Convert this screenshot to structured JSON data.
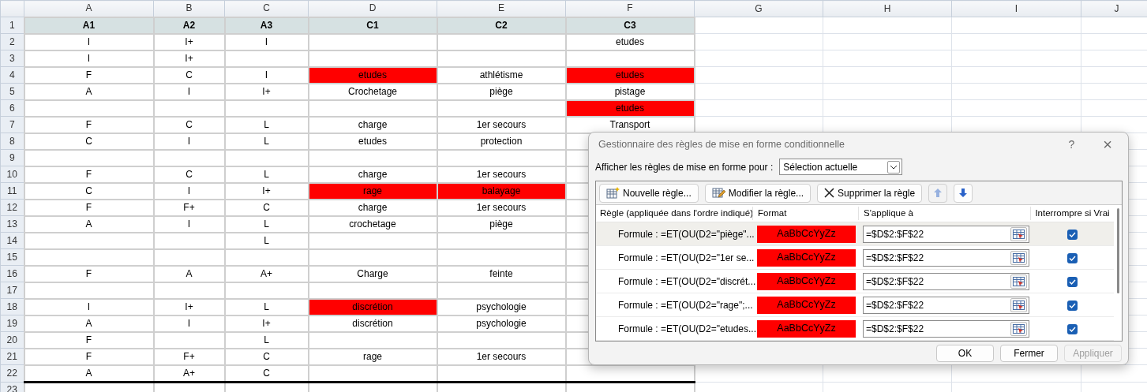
{
  "sheet": {
    "columns": [
      "A",
      "B",
      "C",
      "D",
      "E",
      "F",
      "G",
      "H",
      "I",
      "J"
    ],
    "rows": [
      {
        "number": "1",
        "header": true,
        "cells": [
          {
            "text": "A1",
            "highlighted": false
          },
          {
            "text": "A2",
            "highlighted": false
          },
          {
            "text": "A3",
            "highlighted": false
          },
          {
            "text": "C1",
            "highlighted": false
          },
          {
            "text": "C2",
            "highlighted": false
          },
          {
            "text": "C3",
            "highlighted": false
          }
        ]
      },
      {
        "number": "2",
        "header": false,
        "cells": [
          {
            "text": "I",
            "highlighted": false
          },
          {
            "text": "I+",
            "highlighted": false
          },
          {
            "text": "I",
            "highlighted": false
          },
          {
            "highlighted": false
          },
          {
            "highlighted": false
          },
          {
            "text": "etudes",
            "highlighted": false
          }
        ]
      },
      {
        "number": "3",
        "header": false,
        "cells": [
          {
            "text": "I",
            "highlighted": false
          },
          {
            "text": "I+",
            "highlighted": false
          },
          {
            "highlighted": false
          },
          {
            "highlighted": false
          },
          {
            "highlighted": false
          },
          {
            "highlighted": false
          }
        ]
      },
      {
        "number": "4",
        "header": false,
        "cells": [
          {
            "text": "F",
            "highlighted": false
          },
          {
            "text": "C",
            "highlighted": false
          },
          {
            "text": "I",
            "highlighted": false
          },
          {
            "text": "etudes",
            "highlighted": true
          },
          {
            "text": "athlétisme",
            "highlighted": false
          },
          {
            "text": "etudes",
            "highlighted": true
          }
        ]
      },
      {
        "number": "5",
        "header": false,
        "cells": [
          {
            "text": "A",
            "highlighted": false
          },
          {
            "text": "I",
            "highlighted": false
          },
          {
            "text": "I+",
            "highlighted": false
          },
          {
            "text": "Crochetage",
            "highlighted": false
          },
          {
            "text": "piège",
            "highlighted": false
          },
          {
            "text": "pistage",
            "highlighted": false
          }
        ]
      },
      {
        "number": "6",
        "header": false,
        "cells": [
          {
            "highlighted": false
          },
          {
            "highlighted": false
          },
          {
            "highlighted": false
          },
          {
            "highlighted": false
          },
          {
            "highlighted": false
          },
          {
            "text": "etudes",
            "highlighted": true
          }
        ]
      },
      {
        "number": "7",
        "header": false,
        "cells": [
          {
            "text": "F",
            "highlighted": false
          },
          {
            "text": "C",
            "highlighted": false
          },
          {
            "text": "L",
            "highlighted": false
          },
          {
            "text": "charge",
            "highlighted": false
          },
          {
            "text": "1er secours",
            "highlighted": false
          },
          {
            "text": "Transport",
            "highlighted": false
          }
        ]
      },
      {
        "number": "8",
        "header": false,
        "cells": [
          {
            "text": "C",
            "highlighted": false
          },
          {
            "text": "I",
            "highlighted": false
          },
          {
            "text": "L",
            "highlighted": false
          },
          {
            "text": "etudes",
            "highlighted": false
          },
          {
            "text": "protection",
            "highlighted": false
          },
          {
            "highlighted": false
          }
        ]
      },
      {
        "number": "9",
        "header": false,
        "cells": [
          {
            "highlighted": false
          },
          {
            "highlighted": false
          },
          {
            "highlighted": false
          },
          {
            "highlighted": false
          },
          {
            "highlighted": false
          },
          {
            "highlighted": false
          }
        ]
      },
      {
        "number": "10",
        "header": false,
        "cells": [
          {
            "text": "F",
            "highlighted": false
          },
          {
            "text": "C",
            "highlighted": false
          },
          {
            "text": "L",
            "highlighted": false
          },
          {
            "text": "charge",
            "highlighted": false
          },
          {
            "text": "1er secours",
            "highlighted": false
          },
          {
            "highlighted": false
          }
        ]
      },
      {
        "number": "11",
        "header": false,
        "cells": [
          {
            "text": "C",
            "highlighted": false
          },
          {
            "text": "I",
            "highlighted": false
          },
          {
            "text": "I+",
            "highlighted": false
          },
          {
            "text": "rage",
            "highlighted": true
          },
          {
            "text": "balayage",
            "highlighted": true
          },
          {
            "highlighted": false
          }
        ]
      },
      {
        "number": "12",
        "header": false,
        "cells": [
          {
            "text": "F",
            "highlighted": false
          },
          {
            "text": "F+",
            "highlighted": false
          },
          {
            "text": "C",
            "highlighted": false
          },
          {
            "text": "charge",
            "highlighted": false
          },
          {
            "text": "1er secours",
            "highlighted": false
          },
          {
            "highlighted": false
          }
        ]
      },
      {
        "number": "13",
        "header": false,
        "cells": [
          {
            "text": "A",
            "highlighted": false
          },
          {
            "text": "I",
            "highlighted": false
          },
          {
            "text": "L",
            "highlighted": false
          },
          {
            "text": "crochetage",
            "highlighted": false
          },
          {
            "text": "piège",
            "highlighted": false
          },
          {
            "highlighted": false
          }
        ]
      },
      {
        "number": "14",
        "header": false,
        "cells": [
          {
            "highlighted": false
          },
          {
            "highlighted": false
          },
          {
            "text": "L",
            "highlighted": false
          },
          {
            "highlighted": false
          },
          {
            "highlighted": false
          },
          {
            "highlighted": false
          }
        ]
      },
      {
        "number": "15",
        "header": false,
        "cells": [
          {
            "highlighted": false
          },
          {
            "highlighted": false
          },
          {
            "highlighted": false
          },
          {
            "highlighted": false
          },
          {
            "highlighted": false
          },
          {
            "highlighted": false
          }
        ]
      },
      {
        "number": "16",
        "header": false,
        "cells": [
          {
            "text": "F",
            "highlighted": false
          },
          {
            "text": "A",
            "highlighted": false
          },
          {
            "text": "A+",
            "highlighted": false
          },
          {
            "text": "Charge",
            "highlighted": false
          },
          {
            "text": "feinte",
            "highlighted": false
          },
          {
            "highlighted": false
          }
        ]
      },
      {
        "number": "17",
        "header": false,
        "cells": [
          {
            "highlighted": false
          },
          {
            "highlighted": false
          },
          {
            "highlighted": false
          },
          {
            "highlighted": false
          },
          {
            "highlighted": false
          },
          {
            "highlighted": false
          }
        ]
      },
      {
        "number": "18",
        "header": false,
        "cells": [
          {
            "text": "I",
            "highlighted": false
          },
          {
            "text": "I+",
            "highlighted": false
          },
          {
            "text": "L",
            "highlighted": false
          },
          {
            "text": "discrétion",
            "highlighted": true
          },
          {
            "text": "psychologie",
            "highlighted": false
          },
          {
            "highlighted": false
          }
        ]
      },
      {
        "number": "19",
        "header": false,
        "cells": [
          {
            "text": "A",
            "highlighted": false
          },
          {
            "text": "I",
            "highlighted": false
          },
          {
            "text": "I+",
            "highlighted": false
          },
          {
            "text": "discrétion",
            "highlighted": false
          },
          {
            "text": "psychologie",
            "highlighted": false
          },
          {
            "highlighted": false
          }
        ]
      },
      {
        "number": "20",
        "header": false,
        "cells": [
          {
            "text": "F",
            "highlighted": false
          },
          {
            "highlighted": false
          },
          {
            "text": "L",
            "highlighted": false
          },
          {
            "highlighted": false
          },
          {
            "highlighted": false
          },
          {
            "highlighted": false
          }
        ]
      },
      {
        "number": "21",
        "header": false,
        "cells": [
          {
            "text": "F",
            "highlighted": false
          },
          {
            "text": "F+",
            "highlighted": false
          },
          {
            "text": "C",
            "highlighted": false
          },
          {
            "text": "rage",
            "highlighted": false
          },
          {
            "text": "1er secours",
            "highlighted": false
          },
          {
            "highlighted": false
          }
        ]
      },
      {
        "number": "22",
        "header": false,
        "cells": [
          {
            "text": "A",
            "highlighted": false
          },
          {
            "text": "A+",
            "highlighted": false
          },
          {
            "text": "C",
            "highlighted": false
          },
          {
            "highlighted": false
          },
          {
            "highlighted": false
          },
          {
            "highlighted": false
          }
        ]
      },
      {
        "number": "23",
        "header": false,
        "cells": [
          {
            "highlighted": false
          },
          {
            "highlighted": false
          },
          {
            "highlighted": false
          },
          {
            "highlighted": false
          },
          {
            "highlighted": false
          },
          {
            "highlighted": false
          }
        ]
      }
    ]
  },
  "dialog": {
    "title": "Gestionnaire des règles de mise en forme conditionnelle",
    "help": "?",
    "close": "×",
    "scope_label": "Afficher les règles de mise en forme pour :",
    "scope_value": "Sélection actuelle",
    "toolbar": [
      {
        "kind": "new",
        "label": "Nouvelle règle...",
        "disabled": false
      },
      {
        "kind": "edit",
        "label": "Modifier la règle...",
        "disabled": false
      },
      {
        "kind": "delete",
        "label": "Supprimer la règle",
        "disabled": false
      },
      {
        "kind": "up",
        "disabled": true
      },
      {
        "kind": "down",
        "disabled": false
      }
    ],
    "columns": [
      "Règle (appliquée dans l'ordre indiqué)",
      "Format",
      "S'applique à",
      "Interrompre si Vrai"
    ],
    "rules": [
      {
        "rule": "Formule : =ET(OU(D2=\"piège\"...",
        "format": "AaBbCcYyZz",
        "color": "#ff0000",
        "applies_to": "=$D$2:$F$22",
        "checked": true,
        "selected": true
      },
      {
        "rule": "Formule : =ET(OU(D2=\"1er se...",
        "format": "AaBbCcYyZz",
        "color": "#ff0000",
        "applies_to": "=$D$2:$F$22",
        "checked": true,
        "selected": false
      },
      {
        "rule": "Formule : =ET(OU(D2=\"discrét...",
        "format": "AaBbCcYyZz",
        "color": "#ff0000",
        "applies_to": "=$D$2:$F$22",
        "checked": true,
        "selected": false
      },
      {
        "rule": "Formule : =ET(OU(D2=\"rage\";...",
        "format": "AaBbCcYyZz",
        "color": "#ff0000",
        "applies_to": "=$D$2:$F$22",
        "checked": true,
        "selected": false
      },
      {
        "rule": "Formule : =ET(OU(D2=\"etudes...",
        "format": "AaBbCcYyZz",
        "color": "#ff0000",
        "applies_to": "=$D$2:$F$22",
        "checked": true,
        "selected": false
      }
    ],
    "buttons": [
      {
        "label": "OK",
        "disabled": false
      },
      {
        "label": "Fermer",
        "disabled": false
      },
      {
        "label": "Appliquer",
        "disabled": true
      }
    ]
  }
}
